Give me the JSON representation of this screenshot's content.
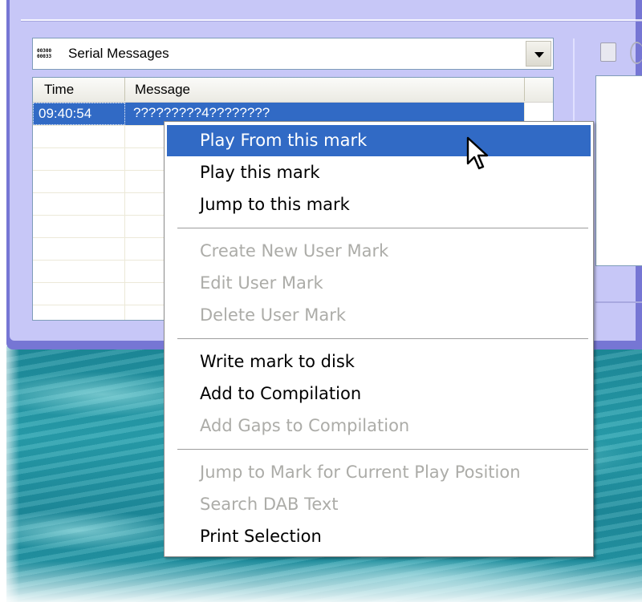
{
  "combo": {
    "selected": "Serial Messages",
    "icon": "serial-data-icon",
    "icon_text": "00300\n00033"
  },
  "list": {
    "columns": [
      "Time",
      "Message"
    ],
    "rows": [
      {
        "time": "09:40:54",
        "message": "?????????4????????"
      }
    ]
  },
  "context_menu": {
    "items": [
      {
        "label": "Play From this mark",
        "enabled": true,
        "highlighted": true
      },
      {
        "label": "Play this mark",
        "enabled": true
      },
      {
        "label": "Jump to this mark",
        "enabled": true
      },
      {
        "label": "Create New User Mark",
        "enabled": false
      },
      {
        "label": "Edit User Mark",
        "enabled": false
      },
      {
        "label": "Delete User Mark",
        "enabled": false
      },
      {
        "label": "Write mark to disk",
        "enabled": true
      },
      {
        "label": "Add to Compilation",
        "enabled": true
      },
      {
        "label": "Add Gaps to Compilation",
        "enabled": false
      },
      {
        "label": "Jump to Mark for Current Play Position",
        "enabled": false
      },
      {
        "label": "Search DAB Text",
        "enabled": false
      },
      {
        "label": "Print Selection",
        "enabled": true
      }
    ]
  },
  "colors": {
    "window_frame": "#7676d4",
    "window_bg": "#c7c7f7",
    "selection": "#316ac5",
    "disabled_text": "#acaca8"
  }
}
